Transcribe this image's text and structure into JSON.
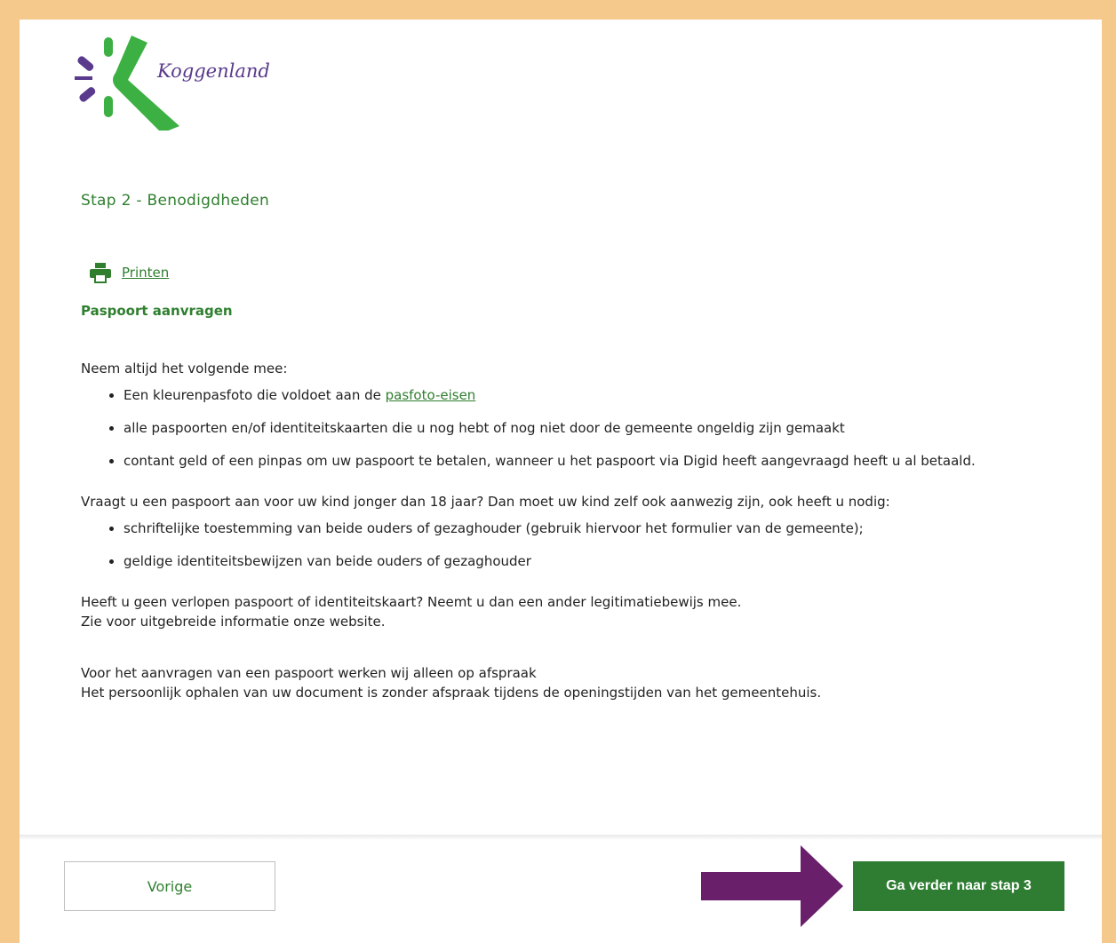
{
  "header": {
    "logo_text": "Koggenland"
  },
  "step": {
    "title": "Stap 2 - Benodigdheden"
  },
  "actions": {
    "print_label": "Printen"
  },
  "section": {
    "title": "Paspoort aanvragen",
    "intro": "Neem altijd het volgende mee:",
    "bullets1": {
      "b1_prefix": "Een kleurenpasfoto die voldoet aan de ",
      "b1_link": "pasfoto-eisen",
      "b2": "alle paspoorten en/of identiteitskaarten die u nog hebt of nog niet door de gemeente ongeldig zijn gemaakt",
      "b3": "contant geld of een pinpas om uw paspoort te betalen, wanneer u het paspoort via Digid heeft aangevraagd heeft u al betaald."
    },
    "child_intro": "Vraagt u een paspoort aan voor uw kind jonger dan 18 jaar? Dan moet uw kind zelf ook aanwezig zijn, ook heeft u nodig:",
    "bullets2": {
      "b1": "schriftelijke toestemming van beide ouders of gezaghouder  (gebruik hiervoor het formulier van de gemeente);",
      "b2": "geldige identiteitsbewijzen van beide ouders of gezaghouder"
    },
    "no_passport_line1": "Heeft u geen verlopen paspoort of identiteitskaart? Neemt u dan een ander legitimatiebewijs mee.",
    "no_passport_line2": "Zie voor uitgebreide informatie onze website.",
    "appointment_line1": "Voor het aanvragen van een  paspoort werken wij alleen op afspraak",
    "appointment_line2": "Het persoonlijk ophalen van uw document is zonder afspraak tijdens de openingstijden van het gemeentehuis."
  },
  "footer": {
    "prev_label": "Vorige",
    "next_label": "Ga verder naar stap 3"
  },
  "colors": {
    "accent_green": "#2e7d32",
    "text_green": "#2f7f2f",
    "logo_purple": "#5a3a8c",
    "border_orange": "#f5c88c",
    "arrow_purple": "#6a1f6b"
  },
  "icons": {
    "print": "printer-icon",
    "arrow": "arrow-right-icon"
  }
}
